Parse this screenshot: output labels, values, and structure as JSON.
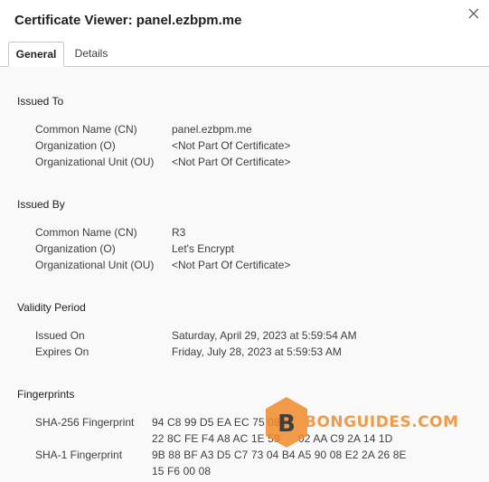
{
  "window": {
    "title": "Certificate Viewer: panel.ezbpm.me",
    "close_icon": "close-icon"
  },
  "tabs": [
    {
      "label": "General",
      "active": true
    },
    {
      "label": "Details",
      "active": false
    }
  ],
  "issued_to": {
    "heading": "Issued To",
    "rows": [
      {
        "label": "Common Name (CN)",
        "value": "panel.ezbpm.me"
      },
      {
        "label": "Organization (O)",
        "value": "<Not Part Of Certificate>"
      },
      {
        "label": "Organizational Unit (OU)",
        "value": "<Not Part Of Certificate>"
      }
    ]
  },
  "issued_by": {
    "heading": "Issued By",
    "rows": [
      {
        "label": "Common Name (CN)",
        "value": "R3"
      },
      {
        "label": "Organization (O)",
        "value": "Let's Encrypt"
      },
      {
        "label": "Organizational Unit (OU)",
        "value": "<Not Part Of Certificate>"
      }
    ]
  },
  "validity": {
    "heading": "Validity Period",
    "rows": [
      {
        "label": "Issued On",
        "value": "Saturday, April 29, 2023 at 5:59:54 AM"
      },
      {
        "label": "Expires On",
        "value": "Friday, July 28, 2023 at 5:59:53 AM"
      }
    ]
  },
  "fingerprints": {
    "heading": "Fingerprints",
    "sha256": {
      "label": "SHA-256 Fingerprint",
      "line1": "94 C8 99 D5 EA EC 75 08",
      "line2": "22 8C FE F4 A8 AC 1E 59",
      "line2_tail": "02 AA C9 2A 14 1D"
    },
    "sha1": {
      "label": "SHA-1 Fingerprint",
      "line1": "9B 88 BF A3 D5 C7 73 04 B4 A5 90 08 E2 2A 26 8E",
      "line2": "15 F6 00 08"
    }
  },
  "watermark": {
    "text": "BONGUIDES.COM",
    "accent": "#f08a2a"
  }
}
